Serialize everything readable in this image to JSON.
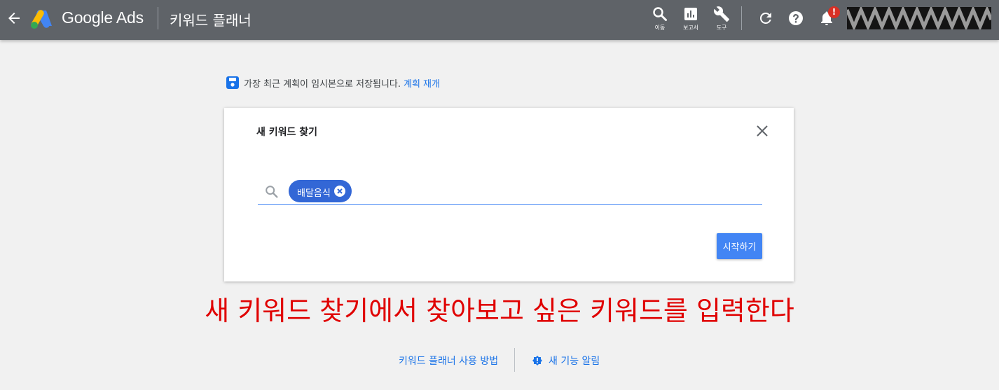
{
  "header": {
    "brand": "Google Ads",
    "page_title": "키워드 플래너",
    "nav_icons": [
      {
        "icon": "search-icon",
        "label": "이동"
      },
      {
        "icon": "reports-icon",
        "label": "보고서"
      },
      {
        "icon": "tools-icon",
        "label": "도구"
      }
    ],
    "notification_badge": "!",
    "colors": {
      "bar": "#5f6368",
      "badge": "#d93025"
    }
  },
  "draft_notice": {
    "text": "가장 최근 계획이 임시본으로 저장됩니다.",
    "link": "계획 재개"
  },
  "dialog": {
    "title": "새 키워드 찾기",
    "chips": [
      "배달음식"
    ],
    "input_value": "",
    "start_button": "시작하기",
    "colors": {
      "chip": "#3367d6",
      "button": "#4285f4"
    }
  },
  "annotation": {
    "text": "새 키워드 찾기에서 찾아보고 싶은 키워드를 입력한다",
    "color": "#e00000"
  },
  "footer": {
    "help_link": "키워드 플래너 사용 방법",
    "news_link": "새 기능 알림"
  }
}
